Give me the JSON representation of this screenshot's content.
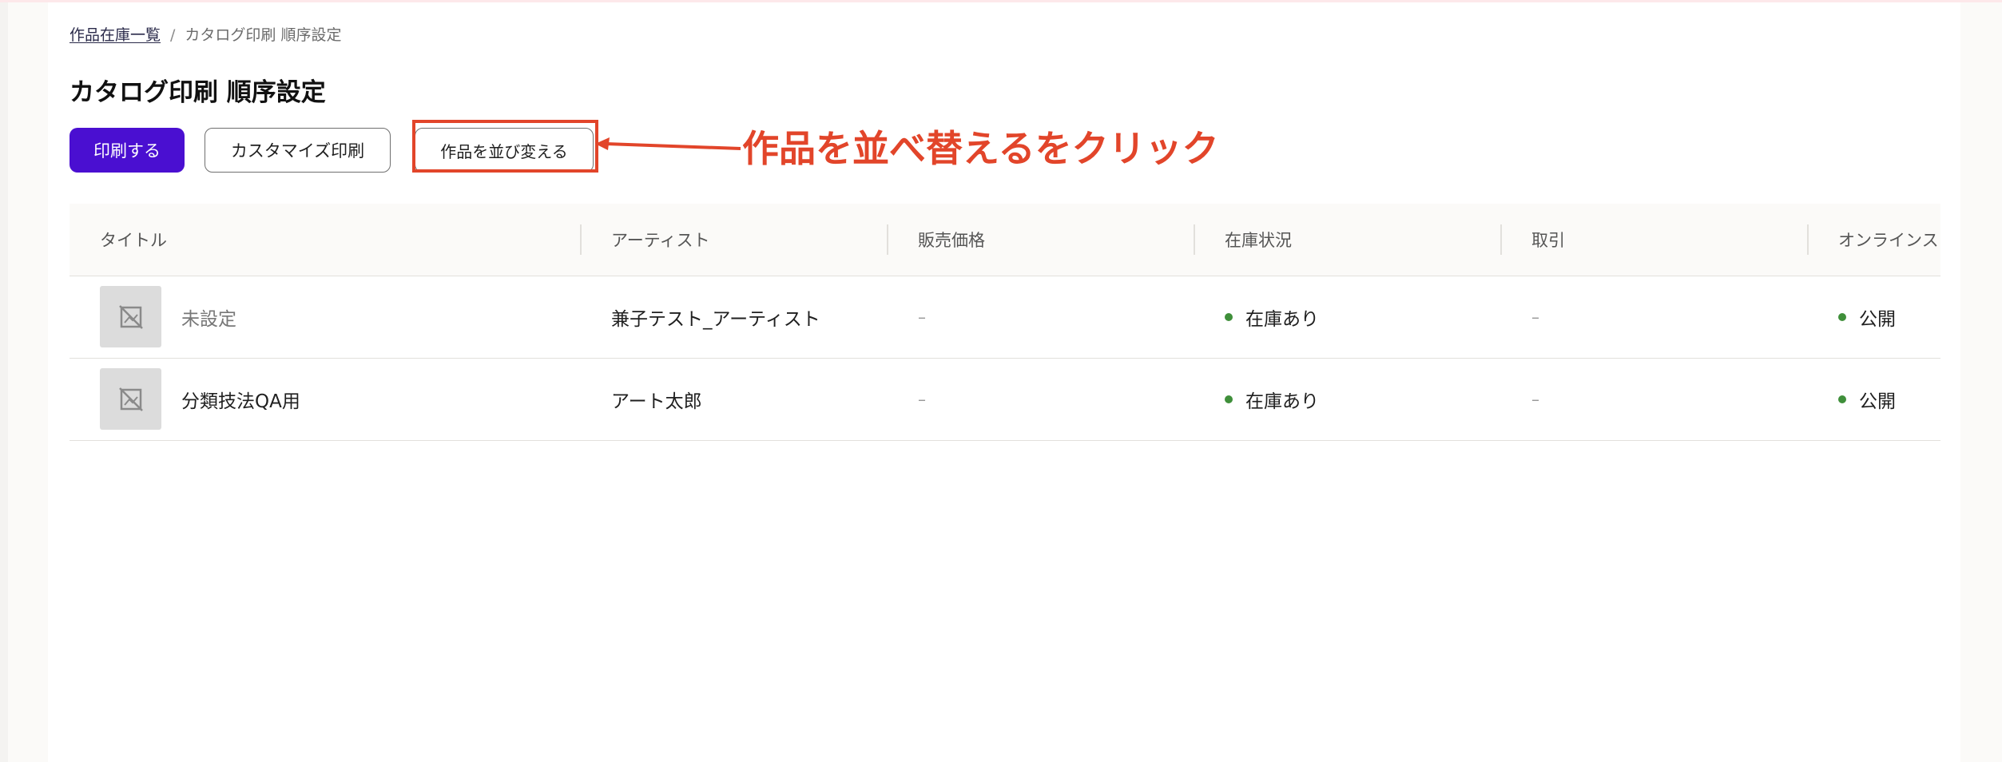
{
  "breadcrumb": {
    "parent": "作品在庫一覧",
    "separator": "/",
    "current": "カタログ印刷 順序設定"
  },
  "page_title": "カタログ印刷 順序設定",
  "toolbar": {
    "print_label": "印刷する",
    "custom_print_label": "カスタマイズ印刷",
    "reorder_label": "作品を並び変える"
  },
  "annotation": {
    "text": "作品を並べ替えるをクリック",
    "color": "#e2452a"
  },
  "table": {
    "headers": [
      "タイトル",
      "アーティスト",
      "販売価格",
      "在庫状況",
      "取引",
      "オンラインス"
    ],
    "rows": [
      {
        "title": "未設定",
        "artist": "兼子テスト_アーティスト",
        "price": "–",
        "stock": "在庫あり",
        "deal": "–",
        "online": "公開"
      },
      {
        "title": "分類技法QA用",
        "artist": "アート太郎",
        "price": "–",
        "stock": "在庫あり",
        "deal": "–",
        "online": "公開"
      }
    ]
  },
  "colors": {
    "primary": "#4a0fd1",
    "status_green": "#3f8f3a",
    "annotation_red": "#e2452a"
  },
  "icons": {
    "thumbnail_placeholder": "no-image-icon"
  }
}
